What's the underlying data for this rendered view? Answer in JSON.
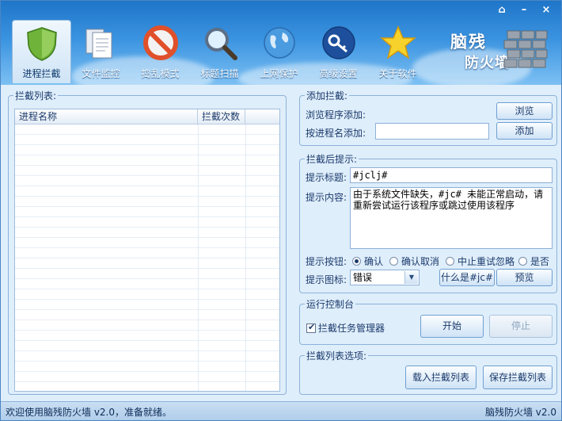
{
  "window": {
    "controls": [
      "⌂",
      "–",
      "×"
    ]
  },
  "logo": {
    "line1": "脑残",
    "line2": "防火墙"
  },
  "tabs": [
    {
      "label": "进程拦截",
      "icon": "shield-icon"
    },
    {
      "label": "文件监控",
      "icon": "documents-icon"
    },
    {
      "label": "捣乱模式",
      "icon": "forbidden-icon"
    },
    {
      "label": "标题扫描",
      "icon": "magnifier-icon"
    },
    {
      "label": "上网保护",
      "icon": "globe-icon"
    },
    {
      "label": "高级设置",
      "icon": "key-icon"
    },
    {
      "label": "关于软件",
      "icon": "star-icon"
    }
  ],
  "intercept_list": {
    "legend": "拦截列表:",
    "columns": [
      "进程名称",
      "拦截次数",
      ""
    ]
  },
  "add_group": {
    "legend": "添加拦截:",
    "browse_label": "浏览程序添加:",
    "browse_button": "浏览",
    "name_label": "按进程名添加:",
    "name_value": "",
    "add_button": "添加"
  },
  "prompt_group": {
    "legend": "拦截后提示:",
    "title_label": "提示标题:",
    "title_value": "#jclj#",
    "content_label": "提示内容:",
    "content_value": "由于系统文件缺失，#jc# 未能正常启动，请重新尝试运行该程序或跳过使用该程序",
    "button_label": "提示按钮:",
    "radios": [
      {
        "label": "确认",
        "selected": true
      },
      {
        "label": "确认取消",
        "selected": false
      },
      {
        "label": "中止重试忽略",
        "selected": false
      },
      {
        "label": "是否",
        "selected": false
      }
    ],
    "icon_label": "提示图标:",
    "icon_select_value": "错误",
    "what_button": "什么是#jc#",
    "preview_button": "预览"
  },
  "console_group": {
    "legend": "运行控制台",
    "taskmgr_checkbox": "拦截任务管理器",
    "taskmgr_checked": true,
    "start_button": "开始",
    "stop_button": "停止"
  },
  "options_group": {
    "legend": "拦截列表选项:",
    "load_button": "载入拦截列表",
    "save_button": "保存拦截列表"
  },
  "status": {
    "left": "欢迎使用脑残防火墙 v2.0，准备就绪。",
    "right": "脑残防火墙 v2.0"
  }
}
